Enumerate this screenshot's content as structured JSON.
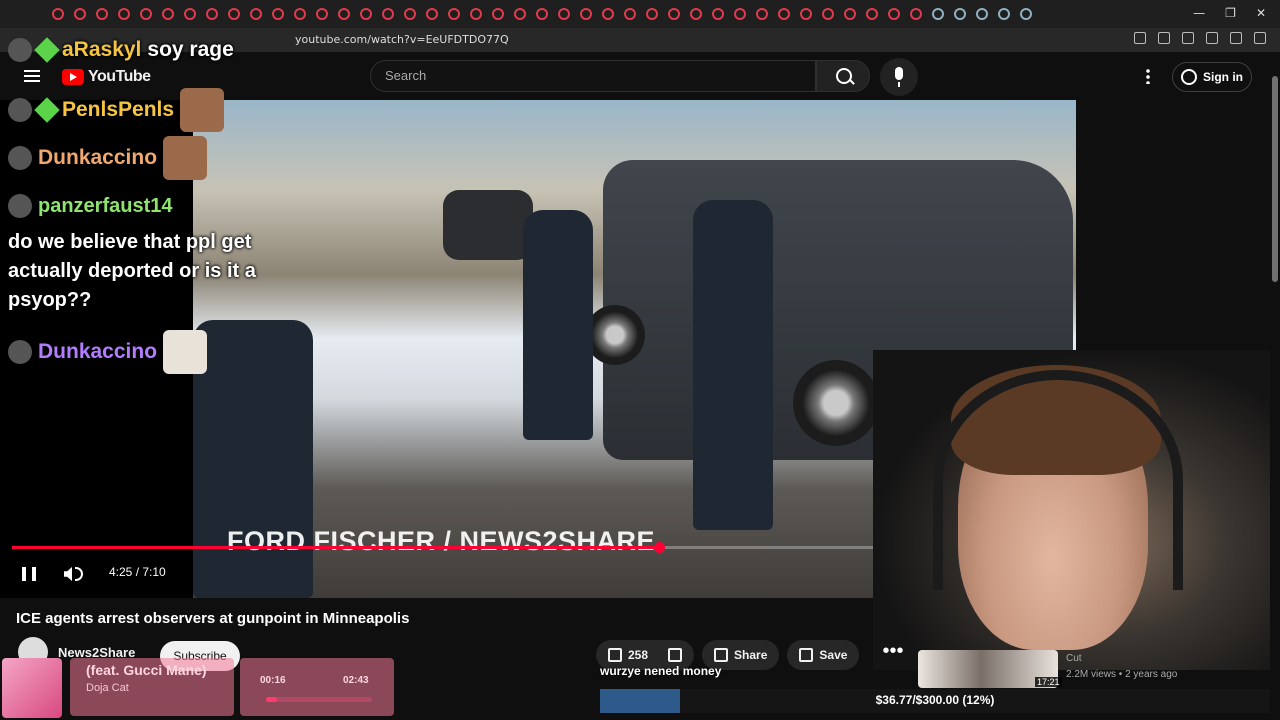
{
  "browser": {
    "url": "youtube.com/watch?v=EeUFDTDO77Q",
    "window_controls": [
      "—",
      "❐",
      "✕"
    ]
  },
  "youtube": {
    "logo_text": "YouTube",
    "search_placeholder": "Search",
    "sign_in_label": "Sign in"
  },
  "chat": [
    {
      "user": "aRaskyl",
      "message": "soy rage",
      "color": "#f5c542"
    },
    {
      "user": "PenlsPenls",
      "message": "",
      "color": "#f5c542"
    },
    {
      "user": "Dunkaccino",
      "message": "",
      "color": "#f0a86e"
    },
    {
      "user": "panzerfaust14",
      "message": "do we believe that ppl get actually deported or is it a psyop??",
      "color": "#8fe36f"
    },
    {
      "user": "Dunkaccino",
      "message": "",
      "color": "#b47cff"
    }
  ],
  "player": {
    "watermark": "FORD FISCHER / NEWS2SHARE",
    "time_display": "4:25 / 7:10",
    "progress_fraction": 0.615
  },
  "video": {
    "title": "ICE agents arrest observers at gunpoint in Minneapolis",
    "channel": "News2Share",
    "subscribe_label": "Subscribe",
    "like_count": "258",
    "share_label": "Share",
    "save_label": "Save",
    "more_label": "•••"
  },
  "overlay": {
    "caption": "wurzye nened money",
    "donation_goal": "$36.77/$300.00 (12%)",
    "donation_fraction": 0.12
  },
  "music": {
    "track": "(feat. Gucci Mane)",
    "artist": "Doja Cat",
    "current": "00:16",
    "duration": "02:43",
    "progress_fraction": 0.1
  },
  "recommendation": {
    "channel": "Cut",
    "meta": "2.2M views • 2 years ago",
    "duration": "17:21"
  }
}
